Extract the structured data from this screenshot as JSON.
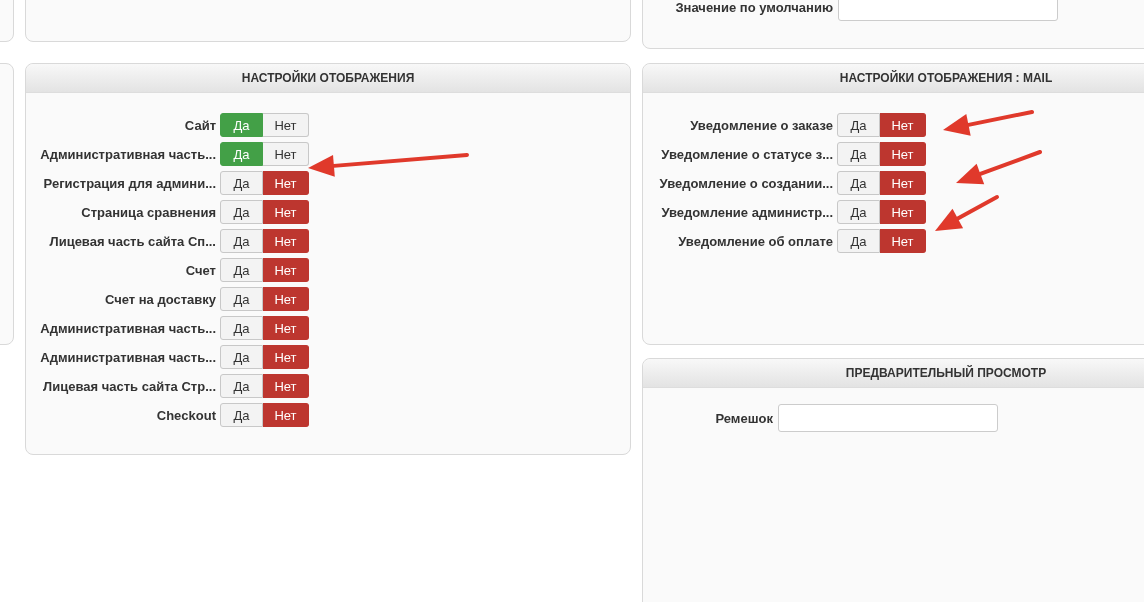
{
  "default_value": {
    "label": "Значение по умолчанию"
  },
  "display_settings": {
    "title": "НАСТРОЙКИ ОТОБРАЖЕНИЯ",
    "rows": [
      {
        "label": "Сайт",
        "options": [
          {
            "label": "Да",
            "selected": true
          },
          {
            "label": "Нет",
            "selected": false
          }
        ]
      },
      {
        "label": "Административная часть...",
        "options": [
          {
            "label": "Да",
            "selected": true
          },
          {
            "label": "Нет",
            "selected": false
          }
        ]
      },
      {
        "label": "Регистрация для админи...",
        "options": [
          {
            "label": "Да",
            "selected": false
          },
          {
            "label": "Нет",
            "selected": true
          }
        ]
      },
      {
        "label": "Страница сравнения",
        "options": [
          {
            "label": "Да",
            "selected": false
          },
          {
            "label": "Нет",
            "selected": true
          }
        ]
      },
      {
        "label": "Лицевая часть сайта Сп...",
        "options": [
          {
            "label": "Да",
            "selected": false
          },
          {
            "label": "Нет",
            "selected": true
          }
        ]
      },
      {
        "label": "Счет",
        "options": [
          {
            "label": "Да",
            "selected": false
          },
          {
            "label": "Нет",
            "selected": true
          }
        ]
      },
      {
        "label": "Счет на доставку",
        "options": [
          {
            "label": "Да",
            "selected": false
          },
          {
            "label": "Нет",
            "selected": true
          }
        ]
      },
      {
        "label": "Административная часть...",
        "options": [
          {
            "label": "Да",
            "selected": false
          },
          {
            "label": "Нет",
            "selected": true
          }
        ]
      },
      {
        "label": "Административная часть...",
        "options": [
          {
            "label": "Да",
            "selected": false
          },
          {
            "label": "Нет",
            "selected": true
          }
        ]
      },
      {
        "label": "Лицевая часть сайта Стр...",
        "options": [
          {
            "label": "Да",
            "selected": false
          },
          {
            "label": "Нет",
            "selected": true
          }
        ]
      },
      {
        "label": "Checkout",
        "options": [
          {
            "label": "Да",
            "selected": false
          },
          {
            "label": "Нет",
            "selected": true
          }
        ]
      }
    ]
  },
  "mail_settings": {
    "title": "НАСТРОЙКИ ОТОБРАЖЕНИЯ : MAIL",
    "rows": [
      {
        "label": "Уведомление о заказе",
        "options": [
          {
            "label": "Да",
            "selected": false
          },
          {
            "label": "Нет",
            "selected": true
          }
        ]
      },
      {
        "label": "Уведомление о статусе з...",
        "options": [
          {
            "label": "Да",
            "selected": false
          },
          {
            "label": "Нет",
            "selected": true
          }
        ]
      },
      {
        "label": "Уведомление о создании...",
        "options": [
          {
            "label": "Да",
            "selected": false
          },
          {
            "label": "Нет",
            "selected": true
          }
        ]
      },
      {
        "label": "Уведомление администр...",
        "options": [
          {
            "label": "Да",
            "selected": false
          },
          {
            "label": "Нет",
            "selected": true
          }
        ]
      },
      {
        "label": "Уведомление об оплате",
        "options": [
          {
            "label": "Да",
            "selected": false
          },
          {
            "label": "Нет",
            "selected": true
          }
        ]
      }
    ]
  },
  "preview": {
    "title": "ПРЕДВАРИТЕЛЬНЫЙ ПРОСМОТР",
    "fields": [
      {
        "label": "Ремешок"
      }
    ]
  }
}
